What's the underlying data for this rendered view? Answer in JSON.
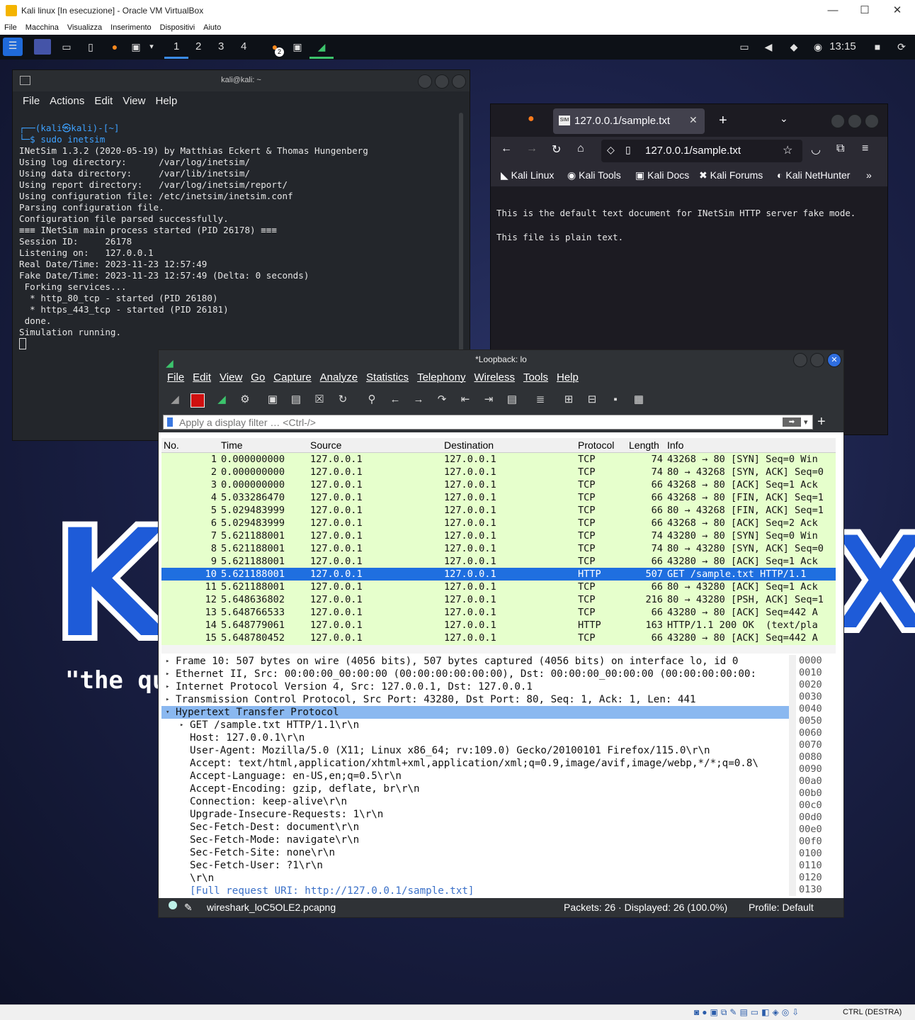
{
  "host": {
    "title": "Kali linux [In esecuzione] - Oracle VM VirtualBox",
    "menu": [
      "File",
      "Macchina",
      "Visualizza",
      "Inserimento",
      "Dispositivi",
      "Aiuto"
    ],
    "status_key": "CTRL (DESTRA)"
  },
  "panel": {
    "workspaces": [
      "1",
      "2",
      "3",
      "4"
    ],
    "notif_count": "2",
    "clock": "13:15"
  },
  "terminal": {
    "title": "kali@kali: ~",
    "menu": [
      "File",
      "Actions",
      "Edit",
      "View",
      "Help"
    ],
    "prompt_user": "┌──(kali㉿kali)-[~]",
    "prompt_cmd": "└─$ sudo inetsim",
    "lines": [
      "INetSim 1.3.2 (2020-05-19) by Matthias Eckert & Thomas Hungenberg",
      "Using log directory:      /var/log/inetsim/",
      "Using data directory:     /var/lib/inetsim/",
      "Using report directory:   /var/log/inetsim/report/",
      "Using configuration file: /etc/inetsim/inetsim.conf",
      "Parsing configuration file.",
      "Configuration file parsed successfully.",
      "≡≡≡ INetSim main process started (PID 26178) ≡≡≡",
      "Session ID:     26178",
      "Listening on:   127.0.0.1",
      "Real Date/Time: 2023-11-23 12:57:49",
      "Fake Date/Time: 2023-11-23 12:57:49 (Delta: 0 seconds)",
      " Forking services...",
      "  * http_80_tcp - started (PID 26180)",
      "  * https_443_tcp - started (PID 26181)",
      " done.",
      "Simulation running."
    ]
  },
  "firefox": {
    "tab_title": "127.0.0.1/sample.txt",
    "url": "127.0.0.1/sample.txt",
    "bookmarks": [
      "Kali Linux",
      "Kali Tools",
      "Kali Docs",
      "Kali Forums",
      "Kali NetHunter"
    ],
    "content_line1": "This is the default text document for INetSim HTTP server fake mode.",
    "content_line2": "This file is plain text."
  },
  "desktop": {
    "logo_text": "K",
    "logo_text_right": "X",
    "tagline": "\"the qu"
  },
  "wireshark": {
    "title": "*Loopback: lo",
    "menu": [
      "File",
      "Edit",
      "View",
      "Go",
      "Capture",
      "Analyze",
      "Statistics",
      "Telephony",
      "Wireless",
      "Tools",
      "Help"
    ],
    "filter_placeholder": "Apply a display filter … <Ctrl-/>",
    "columns": [
      "No.",
      "Time",
      "Source",
      "Destination",
      "Protocol",
      "Length",
      "Info"
    ],
    "packets": [
      {
        "no": "1",
        "time": "0.000000000",
        "src": "127.0.0.1",
        "dst": "127.0.0.1",
        "proto": "TCP",
        "len": "74",
        "info": "43268 → 80 [SYN] Seq=0 Win"
      },
      {
        "no": "2",
        "time": "0.000000000",
        "src": "127.0.0.1",
        "dst": "127.0.0.1",
        "proto": "TCP",
        "len": "74",
        "info": "80 → 43268 [SYN, ACK] Seq=0"
      },
      {
        "no": "3",
        "time": "0.000000000",
        "src": "127.0.0.1",
        "dst": "127.0.0.1",
        "proto": "TCP",
        "len": "66",
        "info": "43268 → 80 [ACK] Seq=1 Ack"
      },
      {
        "no": "4",
        "time": "5.033286470",
        "src": "127.0.0.1",
        "dst": "127.0.0.1",
        "proto": "TCP",
        "len": "66",
        "info": "43268 → 80 [FIN, ACK] Seq=1"
      },
      {
        "no": "5",
        "time": "5.029483999",
        "src": "127.0.0.1",
        "dst": "127.0.0.1",
        "proto": "TCP",
        "len": "66",
        "info": "80 → 43268 [FIN, ACK] Seq=1"
      },
      {
        "no": "6",
        "time": "5.029483999",
        "src": "127.0.0.1",
        "dst": "127.0.0.1",
        "proto": "TCP",
        "len": "66",
        "info": "43268 → 80 [ACK] Seq=2 Ack"
      },
      {
        "no": "7",
        "time": "5.621188001",
        "src": "127.0.0.1",
        "dst": "127.0.0.1",
        "proto": "TCP",
        "len": "74",
        "info": "43280 → 80 [SYN] Seq=0 Win"
      },
      {
        "no": "8",
        "time": "5.621188001",
        "src": "127.0.0.1",
        "dst": "127.0.0.1",
        "proto": "TCP",
        "len": "74",
        "info": "80 → 43280 [SYN, ACK] Seq=0"
      },
      {
        "no": "9",
        "time": "5.621188001",
        "src": "127.0.0.1",
        "dst": "127.0.0.1",
        "proto": "TCP",
        "len": "66",
        "info": "43280 → 80 [ACK] Seq=1 Ack"
      },
      {
        "no": "10",
        "time": "5.621188001",
        "src": "127.0.0.1",
        "dst": "127.0.0.1",
        "proto": "HTTP",
        "len": "507",
        "info": "GET /sample.txt HTTP/1.1"
      },
      {
        "no": "11",
        "time": "5.621188001",
        "src": "127.0.0.1",
        "dst": "127.0.0.1",
        "proto": "TCP",
        "len": "66",
        "info": "80 → 43280 [ACK] Seq=1 Ack"
      },
      {
        "no": "12",
        "time": "5.648636802",
        "src": "127.0.0.1",
        "dst": "127.0.0.1",
        "proto": "TCP",
        "len": "216",
        "info": "80 → 43280 [PSH, ACK] Seq=1"
      },
      {
        "no": "13",
        "time": "5.648766533",
        "src": "127.0.0.1",
        "dst": "127.0.0.1",
        "proto": "TCP",
        "len": "66",
        "info": "43280 → 80 [ACK] Seq=442 A"
      },
      {
        "no": "14",
        "time": "5.648779061",
        "src": "127.0.0.1",
        "dst": "127.0.0.1",
        "proto": "HTTP",
        "len": "163",
        "info": "HTTP/1.1 200 OK  (text/pla"
      },
      {
        "no": "15",
        "time": "5.648780452",
        "src": "127.0.0.1",
        "dst": "127.0.0.1",
        "proto": "TCP",
        "len": "66",
        "info": "43280 → 80 [ACK] Seq=442 A"
      }
    ],
    "details": [
      "Frame 10: 507 bytes on wire (4056 bits), 507 bytes captured (4056 bits) on interface lo, id 0",
      "Ethernet II, Src: 00:00:00_00:00:00 (00:00:00:00:00:00), Dst: 00:00:00_00:00:00 (00:00:00:00:00:",
      "Internet Protocol Version 4, Src: 127.0.0.1, Dst: 127.0.0.1",
      "Transmission Control Protocol, Src Port: 43280, Dst Port: 80, Seq: 1, Ack: 1, Len: 441",
      "Hypertext Transfer Protocol",
      "GET /sample.txt HTTP/1.1\\r\\n",
      "Host: 127.0.0.1\\r\\n",
      "User-Agent: Mozilla/5.0 (X11; Linux x86_64; rv:109.0) Gecko/20100101 Firefox/115.0\\r\\n",
      "Accept: text/html,application/xhtml+xml,application/xml;q=0.9,image/avif,image/webp,*/*;q=0.8\\",
      "Accept-Language: en-US,en;q=0.5\\r\\n",
      "Accept-Encoding: gzip, deflate, br\\r\\n",
      "Connection: keep-alive\\r\\n",
      "Upgrade-Insecure-Requests: 1\\r\\n",
      "Sec-Fetch-Dest: document\\r\\n",
      "Sec-Fetch-Mode: navigate\\r\\n",
      "Sec-Fetch-Site: none\\r\\n",
      "Sec-Fetch-User: ?1\\r\\n",
      "\\r\\n",
      "[Full request URI: http://127.0.0.1/sample.txt]"
    ],
    "bytes_offsets": [
      "0000",
      "0010",
      "0020",
      "0030",
      "0040",
      "0050",
      "0060",
      "0070",
      "0080",
      "0090",
      "00a0",
      "00b0",
      "00c0",
      "00d0",
      "00e0",
      "00f0",
      "0100",
      "0110",
      "0120",
      "0130"
    ],
    "status_file": "wireshark_loC5OLE2.pcapng",
    "status_packets": "Packets: 26 · Displayed: 26 (100.0%)",
    "status_profile": "Profile: Default"
  },
  "colors": {
    "selection": "#1f6fe0",
    "tcp_row": "#e6ffcc",
    "kali_blue": "#1e5bd8"
  }
}
